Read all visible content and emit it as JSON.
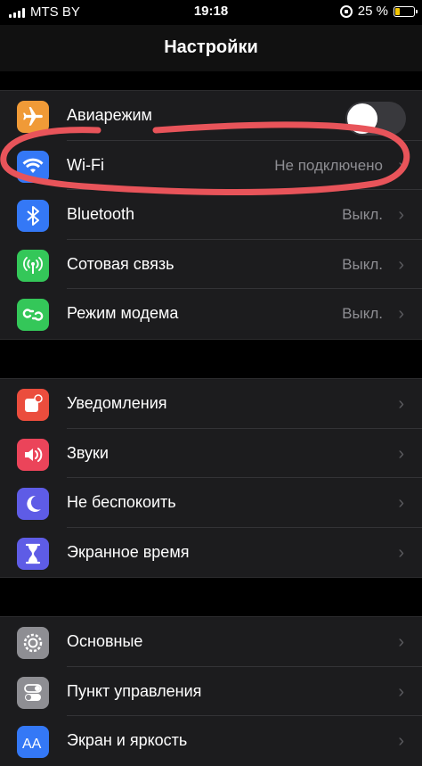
{
  "status": {
    "carrier": "MTS BY",
    "time": "19:18",
    "battery_percent": "25 %",
    "battery_level": 0.25
  },
  "nav": {
    "title": "Настройки"
  },
  "groups": [
    [
      {
        "label": "Авиарежим",
        "icon": "airplane-icon",
        "color": "#f09a37",
        "toggle": false
      },
      {
        "label": "Wi-Fi",
        "value": "Не подключено",
        "icon": "wifi-icon",
        "color": "#3478f6"
      },
      {
        "label": "Bluetooth",
        "value": "Выкл.",
        "icon": "bluetooth-icon",
        "color": "#3478f6"
      },
      {
        "label": "Сотовая связь",
        "value": "Выкл.",
        "icon": "cellular-antenna-icon",
        "color": "#34c759"
      },
      {
        "label": "Режим модема",
        "value": "Выкл.",
        "icon": "personal-hotspot-icon",
        "color": "#34c759"
      }
    ],
    [
      {
        "label": "Уведомления",
        "icon": "notifications-icon",
        "color": "#eb4d3d"
      },
      {
        "label": "Звуки",
        "icon": "speaker-icon",
        "color": "#eb445a"
      },
      {
        "label": "Не беспокоить",
        "icon": "moon-icon",
        "color": "#5e5ce6"
      },
      {
        "label": "Экранное время",
        "icon": "hourglass-icon",
        "color": "#5e5ce6"
      }
    ],
    [
      {
        "label": "Основные",
        "icon": "gear-icon",
        "color": "#8e8e93"
      },
      {
        "label": "Пункт управления",
        "icon": "toggles-icon",
        "color": "#8e8e93"
      },
      {
        "label": "Экран и яркость",
        "icon": "text-size-icon",
        "color": "#3478f6"
      }
    ]
  ],
  "annotation": {
    "color": "#e8545a",
    "shape": "hand-drawn-ellipse-around-wifi"
  }
}
